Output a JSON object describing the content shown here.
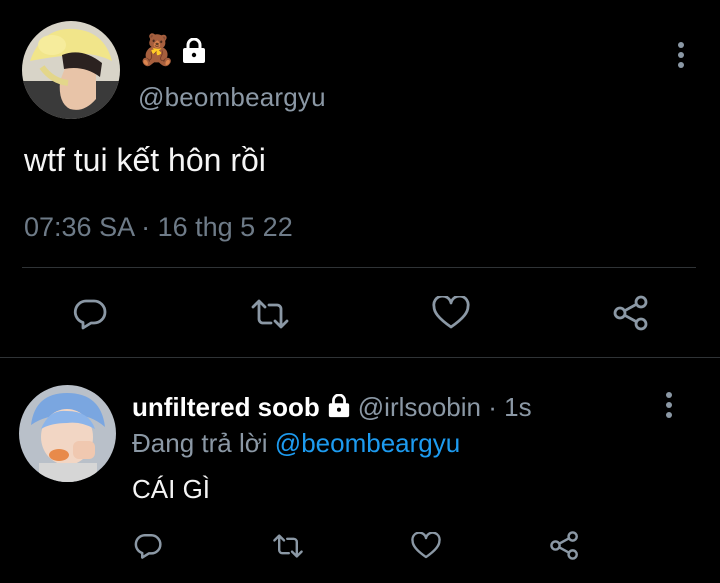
{
  "main_tweet": {
    "emoji": "🧸",
    "handle": "@beombeargyu",
    "text": "wtf tui kết hôn rồi",
    "timestamp": "07:36 SA · 16 thg 5 22",
    "icons": [
      "bear-emoji",
      "lock-icon",
      "more-vertical-icon"
    ]
  },
  "main_actions": [
    "reply-icon",
    "retweet-icon",
    "like-icon",
    "share-icon"
  ],
  "reply": {
    "display_name": "unfiltered soob",
    "meta": "@irlsoobin · 1s",
    "replying_prefix": "Đang trả lời",
    "replying_to": "@beombeargyu",
    "text": "CÁI GÌ"
  },
  "reply_actions": [
    "reply-icon",
    "retweet-icon",
    "like-icon",
    "share-icon"
  ],
  "colors": {
    "background": "#000000",
    "text": "#f5f5f5",
    "secondary": "#8b98a5",
    "mention": "#1d9bf0",
    "divider": "#2f3336"
  }
}
